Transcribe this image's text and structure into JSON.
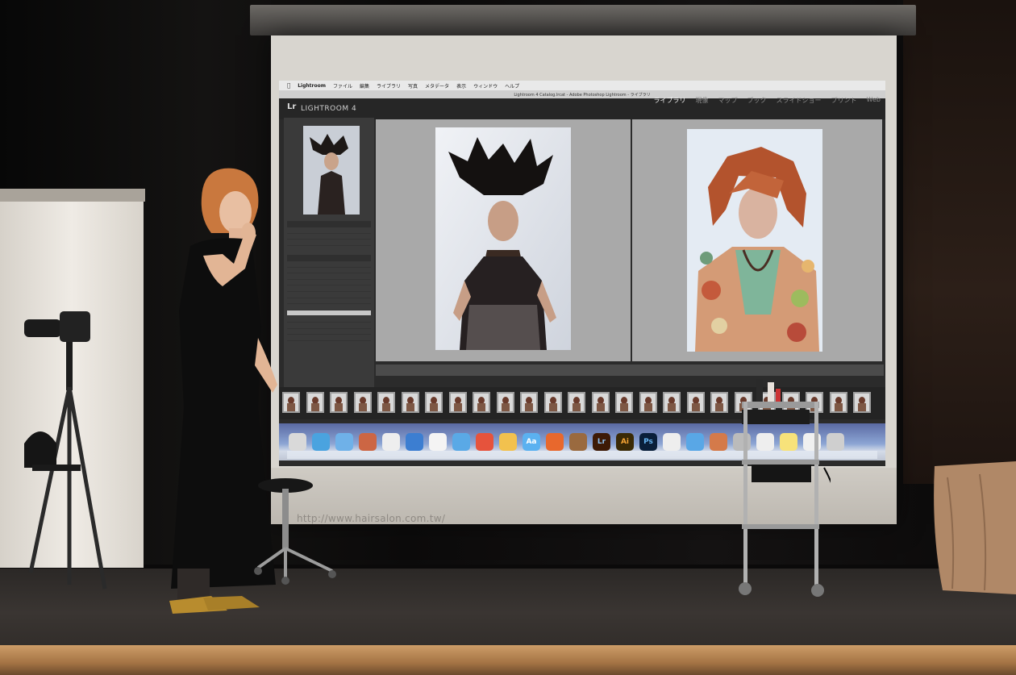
{
  "lightroom": {
    "menubar": [
      "Lightroom",
      "ファイル",
      "編集",
      "ライブラリ",
      "写真",
      "メタデータ",
      "表示",
      "ウィンドウ",
      "ヘルプ"
    ],
    "window_title": "Lightroom 4 Catalog.lrcat - Adobe Photoshop Lightroom - ライブラリ",
    "logo": "Lr",
    "app_name": "LIGHTROOM 4",
    "modules": [
      "ライブラリ",
      "現像",
      "マップ",
      "ブック",
      "スライドショー",
      "プリント",
      "Web"
    ],
    "active_module": "ライブラリ",
    "dock_badges": [
      "Lr",
      "Ai",
      "Ps",
      "Aa"
    ]
  },
  "watermark": "http://www.hairsalon.com.tw/",
  "colors": {
    "screen": "#d8d5cf",
    "lightroom_bg": "#2b2b2b",
    "stage_edge": "#b5824f"
  }
}
